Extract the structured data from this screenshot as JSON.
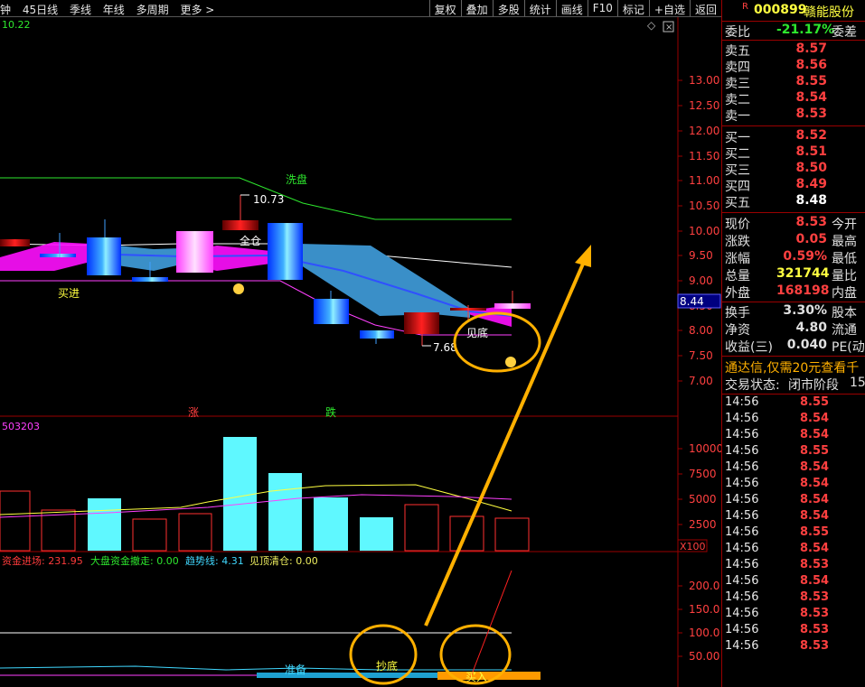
{
  "toolbar": {
    "left_items": [
      "钟",
      "45日线",
      "季线",
      "年线",
      "多周期",
      "更多 >"
    ],
    "right_items": [
      "复权",
      "叠加",
      "多股",
      "统计",
      "画线",
      "F10",
      "标记",
      "+自选",
      "返回"
    ]
  },
  "main_chart": {
    "info_value": "10.22",
    "price_axis": [
      "13.00",
      "12.50",
      "12.00",
      "11.50",
      "11.00",
      "10.50",
      "10.00",
      "9.50",
      "9.00",
      "8.50",
      "8.00",
      "7.50",
      "7.00"
    ],
    "current_price_tag": "8.44",
    "annotations": {
      "xipan": "洗盘",
      "high": "10.73",
      "quancang": "全仓",
      "maijin": "买进",
      "jiandi": "见底",
      "low": "7.68",
      "zhang": "涨",
      "die": "跌"
    }
  },
  "volume_chart": {
    "info_value": "503203",
    "axis": [
      "10000",
      "7500",
      "5000",
      "2500"
    ],
    "unit": "X100"
  },
  "indicator_chart": {
    "legend": [
      {
        "label": "资金进场: 231.95",
        "color": "#ff3b3b"
      },
      {
        "label": "大盘资金撤走: 0.00",
        "color": "#2ee82e"
      },
      {
        "label": "趋势线: 4.31",
        "color": "#40d8ff"
      },
      {
        "label": "见顶清仓: 0.00",
        "color": "#f0f060"
      }
    ],
    "axis": [
      "200.0",
      "150.0",
      "100.0",
      "50.00"
    ],
    "labels": {
      "zhunbei": "准备",
      "chaodi": "抄底",
      "mairu": "买入"
    }
  },
  "stock": {
    "badge": "R",
    "code": "000899",
    "name": "赣能股份"
  },
  "weibi": {
    "label": "委比",
    "value": "-21.17%",
    "label2": "委差"
  },
  "sell_orders": [
    {
      "label": "卖五",
      "price": "8.57"
    },
    {
      "label": "卖四",
      "price": "8.56"
    },
    {
      "label": "卖三",
      "price": "8.55"
    },
    {
      "label": "卖二",
      "price": "8.54"
    },
    {
      "label": "卖一",
      "price": "8.53"
    }
  ],
  "buy_orders": [
    {
      "label": "买一",
      "price": "8.52"
    },
    {
      "label": "买二",
      "price": "8.51"
    },
    {
      "label": "买三",
      "price": "8.50"
    },
    {
      "label": "买四",
      "price": "8.49"
    },
    {
      "label": "买五",
      "price": "8.48"
    }
  ],
  "quote": [
    {
      "label": "现价",
      "value": "8.53",
      "label2": "今开",
      "color": "#ff4040"
    },
    {
      "label": "涨跌",
      "value": "0.05",
      "label2": "最高",
      "color": "#ff4040"
    },
    {
      "label": "涨幅",
      "value": "0.59%",
      "label2": "最低",
      "color": "#ff4040"
    },
    {
      "label": "总量",
      "value": "321744",
      "label2": "量比",
      "color": "#ffff40"
    },
    {
      "label": "外盘",
      "value": "168198",
      "label2": "内盘",
      "color": "#ff4040"
    }
  ],
  "fundamentals": [
    {
      "label": "换手",
      "value": "3.30%",
      "label2": "股本"
    },
    {
      "label": "净资",
      "value": "4.80",
      "label2": "流通"
    },
    {
      "label": "收益(三)",
      "value": "0.040",
      "label2": "PE(动"
    }
  ],
  "promo": "通达信,仅需20元查看千",
  "status": {
    "label": "交易状态:",
    "value": "闭市阶段",
    "extra": "15"
  },
  "ticks": [
    {
      "time": "14:56",
      "price": "8.55",
      "color": "#ff4040"
    },
    {
      "time": "14:56",
      "price": "8.54",
      "color": "#ff4040"
    },
    {
      "time": "14:56",
      "price": "8.54",
      "color": "#ff4040"
    },
    {
      "time": "14:56",
      "price": "8.55",
      "color": "#ff4040"
    },
    {
      "time": "14:56",
      "price": "8.54",
      "color": "#ff4040"
    },
    {
      "time": "14:56",
      "price": "8.54",
      "color": "#ff4040"
    },
    {
      "time": "14:56",
      "price": "8.54",
      "color": "#ff4040"
    },
    {
      "time": "14:56",
      "price": "8.54",
      "color": "#ff4040"
    },
    {
      "time": "14:56",
      "price": "8.55",
      "color": "#ff4040"
    },
    {
      "time": "14:56",
      "price": "8.54",
      "color": "#ff4040"
    },
    {
      "time": "14:56",
      "price": "8.53",
      "color": "#ff4040"
    },
    {
      "time": "14:56",
      "price": "8.54",
      "color": "#ff4040"
    },
    {
      "time": "14:56",
      "price": "8.53",
      "color": "#ff4040"
    },
    {
      "time": "14:56",
      "price": "8.53",
      "color": "#ff4040"
    },
    {
      "time": "14:56",
      "price": "8.53",
      "color": "#ff4040"
    },
    {
      "time": "14:56",
      "price": "8.53",
      "color": "#ff4040"
    }
  ]
}
